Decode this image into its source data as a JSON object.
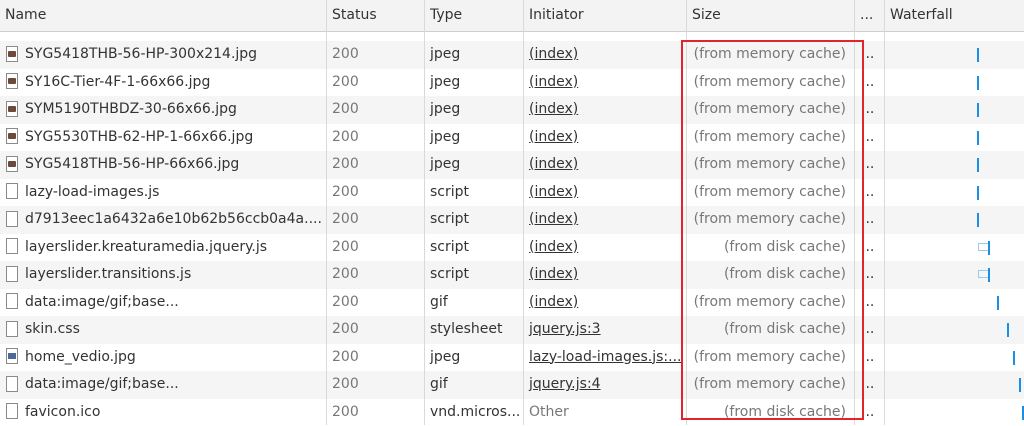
{
  "columns": {
    "name": "Name",
    "status": "Status",
    "type": "Type",
    "initiator": "Initiator",
    "size": "Size",
    "more": "...",
    "waterfall": "Waterfall"
  },
  "rows": [
    {
      "name": "SYG5418THB-56-HP-300x214.jpg",
      "status": "200",
      "type": "jpeg",
      "initiator": "(index)",
      "size": "(from memory cache)",
      "dots": "...",
      "icon": "image-icon"
    },
    {
      "name": "SY16C-Tier-4F-1-66x66.jpg",
      "status": "200",
      "type": "jpeg",
      "initiator": "(index)",
      "size": "(from memory cache)",
      "dots": "...",
      "icon": "image-icon"
    },
    {
      "name": "SYM5190THBDZ-30-66x66.jpg",
      "status": "200",
      "type": "jpeg",
      "initiator": "(index)",
      "size": "(from memory cache)",
      "dots": "...",
      "icon": "image-icon"
    },
    {
      "name": "SYG5530THB-62-HP-1-66x66.jpg",
      "status": "200",
      "type": "jpeg",
      "initiator": "(index)",
      "size": "(from memory cache)",
      "dots": "...",
      "icon": "image-icon"
    },
    {
      "name": "SYG5418THB-56-HP-66x66.jpg",
      "status": "200",
      "type": "jpeg",
      "initiator": "(index)",
      "size": "(from memory cache)",
      "dots": "...",
      "icon": "image-icon"
    },
    {
      "name": "lazy-load-images.js",
      "status": "200",
      "type": "script",
      "initiator": "(index)",
      "size": "(from memory cache)",
      "dots": "...",
      "icon": "file-icon"
    },
    {
      "name": "d7913eec1a6432a6e10b62b56ccb0a4a....",
      "status": "200",
      "type": "script",
      "initiator": "(index)",
      "size": "(from memory cache)",
      "dots": "...",
      "icon": "file-icon"
    },
    {
      "name": "layerslider.kreaturamedia.jquery.js",
      "status": "200",
      "type": "script",
      "initiator": "(index)",
      "size": "(from disk cache)",
      "dots": "...",
      "icon": "file-icon"
    },
    {
      "name": "layerslider.transitions.js",
      "status": "200",
      "type": "script",
      "initiator": "(index)",
      "size": "(from disk cache)",
      "dots": "...",
      "icon": "file-icon"
    },
    {
      "name": "data:image/gif;base...",
      "status": "200",
      "type": "gif",
      "initiator": "(index)",
      "size": "(from memory cache)",
      "dots": "...",
      "icon": "file-icon"
    },
    {
      "name": "skin.css",
      "status": "200",
      "type": "stylesheet",
      "initiator": "jquery.js:3",
      "size": "(from disk cache)",
      "dots": "...",
      "icon": "file-icon"
    },
    {
      "name": "home_vedio.jpg",
      "status": "200",
      "type": "jpeg",
      "initiator": "lazy-load-images.js:...",
      "size": "(from memory cache)",
      "dots": "...",
      "icon": "image-icon"
    },
    {
      "name": "data:image/gif;base...",
      "status": "200",
      "type": "gif",
      "initiator": "jquery.js:4",
      "size": "(from memory cache)",
      "dots": "...",
      "icon": "file-icon"
    },
    {
      "name": "favicon.ico",
      "status": "200",
      "type": "vnd.micros...",
      "initiator": "Other",
      "size": "(from disk cache)",
      "dots": "...",
      "icon": "file-icon"
    }
  ],
  "colors": {
    "highlight_box": "#e0262d",
    "waterfall_bar": "#1a8fe3"
  }
}
